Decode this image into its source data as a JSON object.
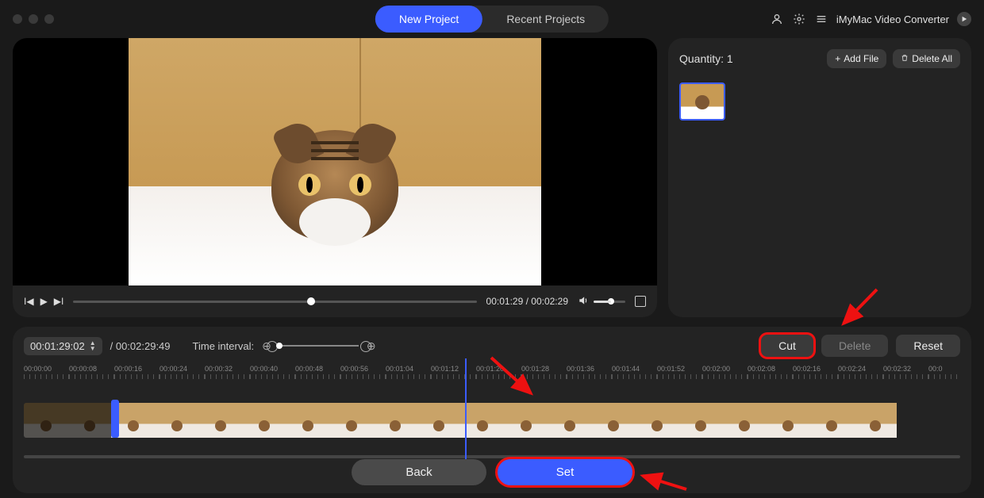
{
  "titlebar": {
    "tabs": {
      "new_project": "New Project",
      "recent_projects": "Recent Projects"
    },
    "app_name": "iMyMac Video Converter"
  },
  "player": {
    "current_time": "00:01:29",
    "total_time": "00:02:29"
  },
  "sidebar": {
    "quantity_label": "Quantity:",
    "quantity_value": "1",
    "add_file": "Add File",
    "delete_all": "Delete All"
  },
  "editor": {
    "time_input": "00:01:29:02",
    "duration": "00:02:29:49",
    "time_interval_label": "Time interval:",
    "actions": {
      "cut": "Cut",
      "delete": "Delete",
      "reset": "Reset"
    },
    "ruler_ticks": [
      "00:00:00",
      "00:00:08",
      "00:00:16",
      "00:00:24",
      "00:00:32",
      "00:00:40",
      "00:00:48",
      "00:00:56",
      "00:01:04",
      "00:01:12",
      "00:01:20",
      "00:01:28",
      "00:01:36",
      "00:01:44",
      "00:01:52",
      "00:02:00",
      "00:02:08",
      "00:02:16",
      "00:02:24",
      "00:02:32",
      "00:0"
    ],
    "bottom": {
      "back": "Back",
      "set": "Set"
    }
  }
}
